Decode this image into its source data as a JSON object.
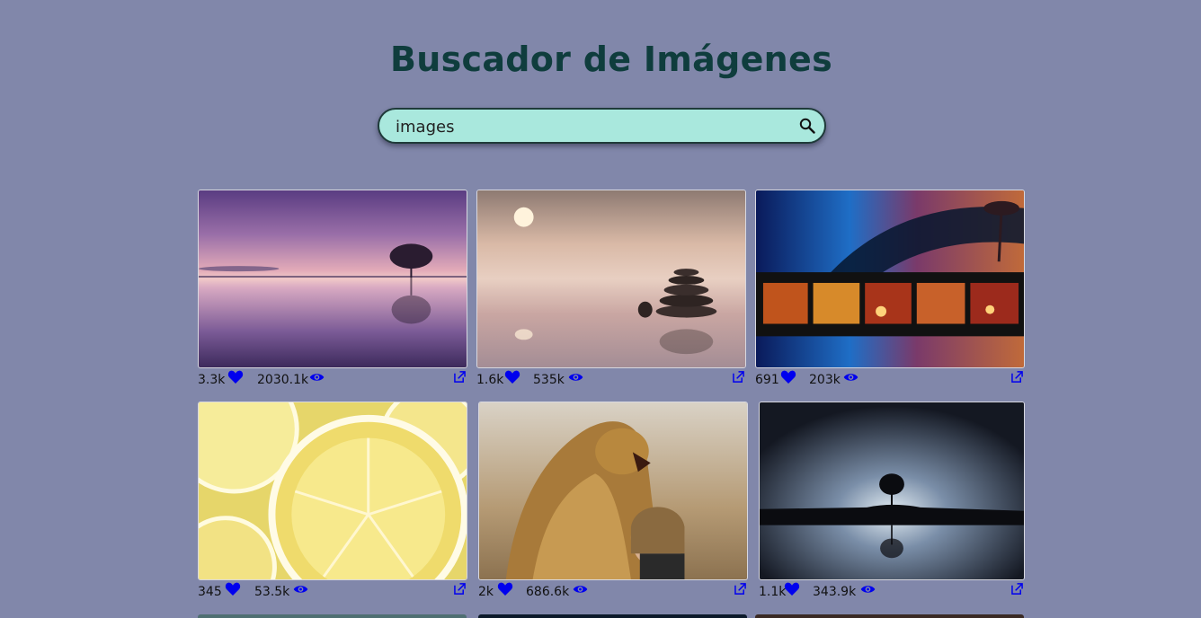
{
  "header": {
    "title": "Buscador de Imágenes"
  },
  "search": {
    "value": "images",
    "icon": "search-icon"
  },
  "icons": {
    "likes": "heart-icon",
    "views": "eye-icon",
    "open": "external-link-icon"
  },
  "colors": {
    "background": "#8187aa",
    "title": "#0f3d3d",
    "search_bg": "#a9e8dd",
    "icon_blue": "#0000ee"
  },
  "gallery": {
    "images": [
      {
        "subject": "purple sunset lake with tree",
        "likes": "3.3k",
        "views": "2030.1k"
      },
      {
        "subject": "zen stones on calm water",
        "likes": "1.6k",
        "views": "535k"
      },
      {
        "subject": "film strip",
        "likes": "691",
        "views": "203k"
      },
      {
        "subject": "lemon slices",
        "likes": "345",
        "views": "53.5k"
      },
      {
        "subject": "lion and girl",
        "likes": "2k",
        "views": "686.6k"
      },
      {
        "subject": "tree reflection at night",
        "likes": "1.1k",
        "views": "343.9k"
      }
    ]
  }
}
